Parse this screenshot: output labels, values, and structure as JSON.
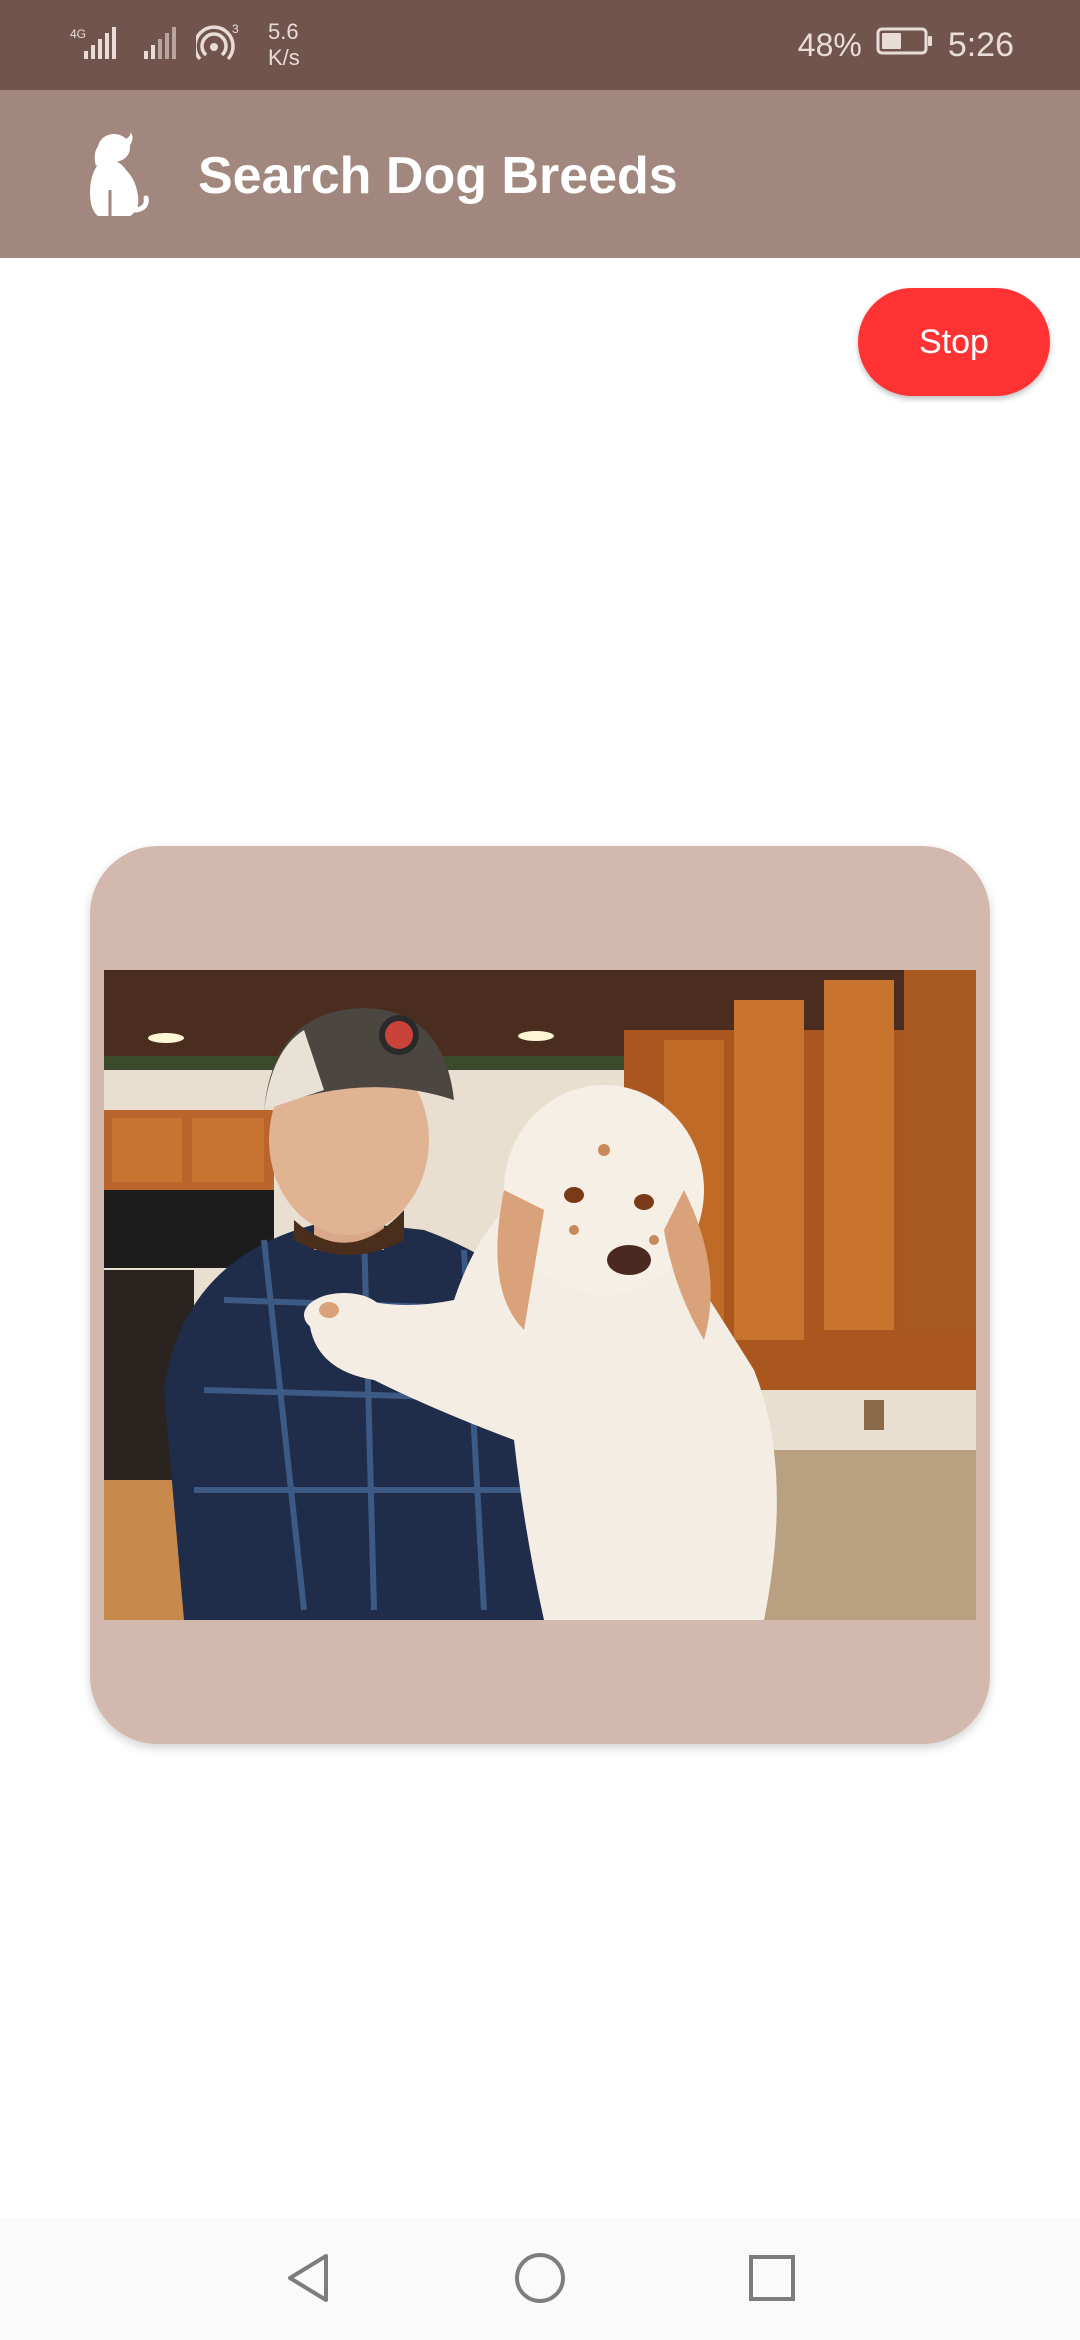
{
  "status_bar": {
    "network_type": "4G",
    "hotspot_count": "3",
    "speed_value": "5.6",
    "speed_unit": "K/s",
    "battery_percent": "48%",
    "battery_level": 0.48,
    "time": "5:26"
  },
  "app_bar": {
    "title": "Search Dog Breeds",
    "icon": "dog-silhouette-icon"
  },
  "actions": {
    "stop_label": "Stop"
  },
  "card": {
    "image": "dog-photo"
  },
  "colors": {
    "status_bar_bg": "#71554c",
    "app_bar_bg": "#a1877d",
    "card_bg": "#d3b8ad",
    "stop_button_bg": "#ff3333"
  },
  "nav_bar": {
    "icons": [
      "back-icon",
      "home-icon",
      "recents-icon"
    ]
  }
}
